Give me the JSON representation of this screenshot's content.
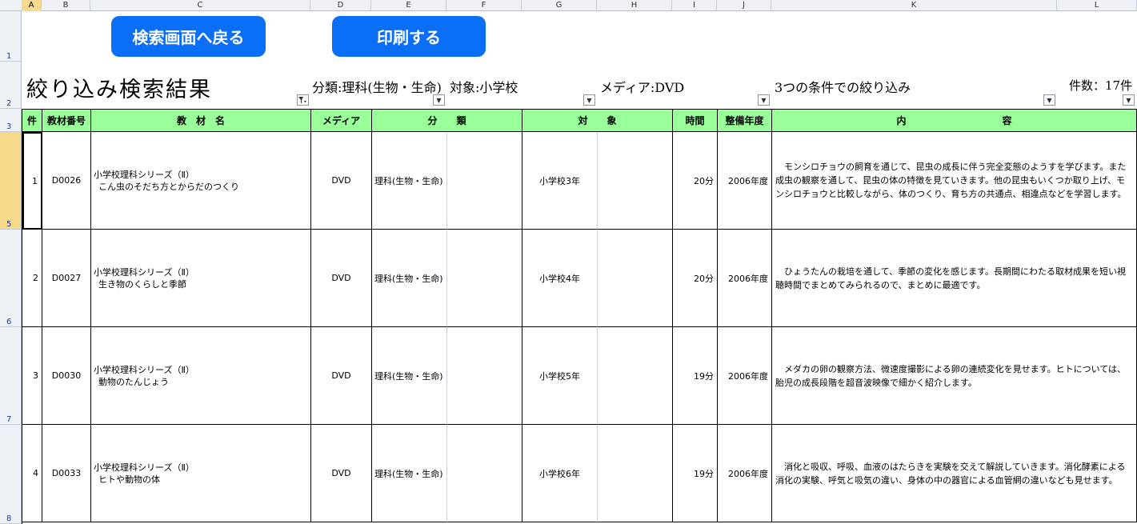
{
  "columns": [
    "A",
    "B",
    "C",
    "D",
    "E",
    "F",
    "G",
    "H",
    "I",
    "J",
    "K",
    "L"
  ],
  "rows": [
    "1",
    "2",
    "3",
    "5",
    "6",
    "7",
    "8"
  ],
  "buttons": {
    "back": "検索画面へ戻る",
    "print": "印刷する"
  },
  "header": {
    "title": "絞り込み検索結果",
    "category": "分類:理科(生物・生命)",
    "target": "対象:小学校",
    "media": "メディア:DVD",
    "condition": "3つの条件での絞り込み",
    "count": "件数：17件"
  },
  "table": {
    "headers": [
      "件",
      "教材番号",
      "教　材　名",
      "メディア",
      "分　　類",
      "対　　象",
      "時間",
      "整備年度",
      "内　　　　　　　　　　容"
    ],
    "rows": [
      {
        "no": "1",
        "code": "D0026",
        "name_line1": "小学校理科シリーズ（Ⅱ）",
        "name_line2": "こん虫のそだち方とからだのつくり",
        "media": "DVD",
        "category": "理科(生物・生命)",
        "target": "小学校3年",
        "time": "20分",
        "year": "2006年度",
        "content": "　モンシロチョウの飼育を通じて、昆虫の成長に伴う完全変態のようすを学びます。また成虫の観察を通して、昆虫の体の特徴を見ていきます。他の昆虫もいくつか取り上げ、モンシロチョウと比較しながら、体のつくり、育ち方の共通点、相違点などを学習します。"
      },
      {
        "no": "2",
        "code": "D0027",
        "name_line1": "小学校理科シリーズ（Ⅱ）",
        "name_line2": "生き物のくらしと季節",
        "media": "DVD",
        "category": "理科(生物・生命)",
        "target": "小学校4年",
        "time": "20分",
        "year": "2006年度",
        "content": "　ひょうたんの栽培を通して、季節の変化を感じます。長期間にわたる取材成果を短い視聴時間でまとめてみられるので、まとめに最適です。"
      },
      {
        "no": "3",
        "code": "D0030",
        "name_line1": "小学校理科シリーズ（Ⅱ）",
        "name_line2": "動物のたんじょう",
        "media": "DVD",
        "category": "理科(生物・生命)",
        "target": "小学校5年",
        "time": "19分",
        "year": "2006年度",
        "content": "　メダカの卵の観察方法、微速度撮影による卵の連続変化を見せます。ヒトについては、胎児の成長段階を超音波映像で細かく紹介します。"
      },
      {
        "no": "4",
        "code": "D0033",
        "name_line1": "小学校理科シリーズ（Ⅱ）",
        "name_line2": "ヒトや動物の体",
        "media": "DVD",
        "category": "理科(生物・生命)",
        "target": "小学校6年",
        "time": "19分",
        "year": "2006年度",
        "content": "　消化と吸収、呼吸、血液のはたらきを実験を交えて解説していきます。消化酵素による消化の実験、呼気と吸気の違い、身体の中の器官による血管網の違いなども見せます。"
      }
    ]
  }
}
